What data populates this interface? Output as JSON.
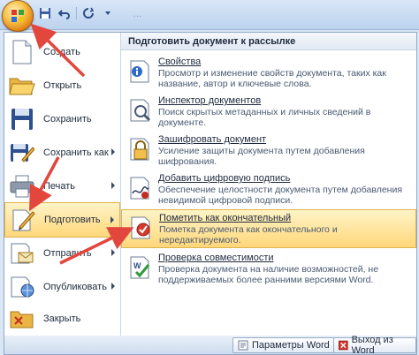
{
  "quick_access": {
    "items": [
      {
        "name": "save-icon"
      },
      {
        "name": "undo-icon"
      },
      {
        "name": "redo-icon"
      }
    ],
    "title_ghost": "…"
  },
  "left_menu": {
    "items": [
      {
        "id": "new",
        "label": "Создать",
        "icon": "new-document-icon",
        "submenu": false
      },
      {
        "id": "open",
        "label": "Открыть",
        "icon": "open-folder-icon",
        "submenu": false
      },
      {
        "id": "save",
        "label": "Сохранить",
        "icon": "save-icon",
        "submenu": false
      },
      {
        "id": "save-as",
        "label": "Сохранить как",
        "icon": "save-as-icon",
        "submenu": true
      },
      {
        "id": "print",
        "label": "Печать",
        "icon": "printer-icon",
        "submenu": true
      },
      {
        "id": "prepare",
        "label": "Подготовить",
        "icon": "prepare-pencil-icon",
        "submenu": true,
        "active": true
      },
      {
        "id": "send",
        "label": "Отправить",
        "icon": "send-mail-icon",
        "submenu": true
      },
      {
        "id": "publish",
        "label": "Опубликовать",
        "icon": "publish-icon",
        "submenu": true
      },
      {
        "id": "close",
        "label": "Закрыть",
        "icon": "close-folder-icon",
        "submenu": false
      }
    ]
  },
  "submenu": {
    "header": "Подготовить документ к рассылке",
    "items": [
      {
        "title": "Свойства",
        "desc": "Просмотр и изменение свойств документа, таких как название, автор и ключевые слова.",
        "icon": "properties-icon"
      },
      {
        "title": "Инспектор документов",
        "desc": "Поиск скрытых метаданных и личных сведений в документе.",
        "icon": "inspector-icon"
      },
      {
        "title": "Зашифровать документ",
        "desc": "Усиление защиты документа путем добавления шифрования.",
        "icon": "encrypt-lock-icon"
      },
      {
        "title": "Добавить цифровую подпись",
        "desc": "Обеспечение целостности документа путем добавления невидимой цифровой подписи.",
        "icon": "signature-icon"
      },
      {
        "title": "Пометить как окончательный",
        "desc": "Пометка документа как окончательного и нередактируемого.",
        "icon": "mark-final-icon",
        "active": true
      },
      {
        "title": "Проверка совместимости",
        "desc": "Проверка документа на наличие возможностей, не поддерживаемых более ранними версиями Word.",
        "icon": "compatibility-icon"
      }
    ]
  },
  "bottom": {
    "options_label": "Параметры Word",
    "exit_label": "Выход из Word"
  },
  "colors": {
    "highlight_top": "#fff4c7",
    "highlight_bottom": "#ffd77a",
    "arrow": "#e2463c"
  }
}
